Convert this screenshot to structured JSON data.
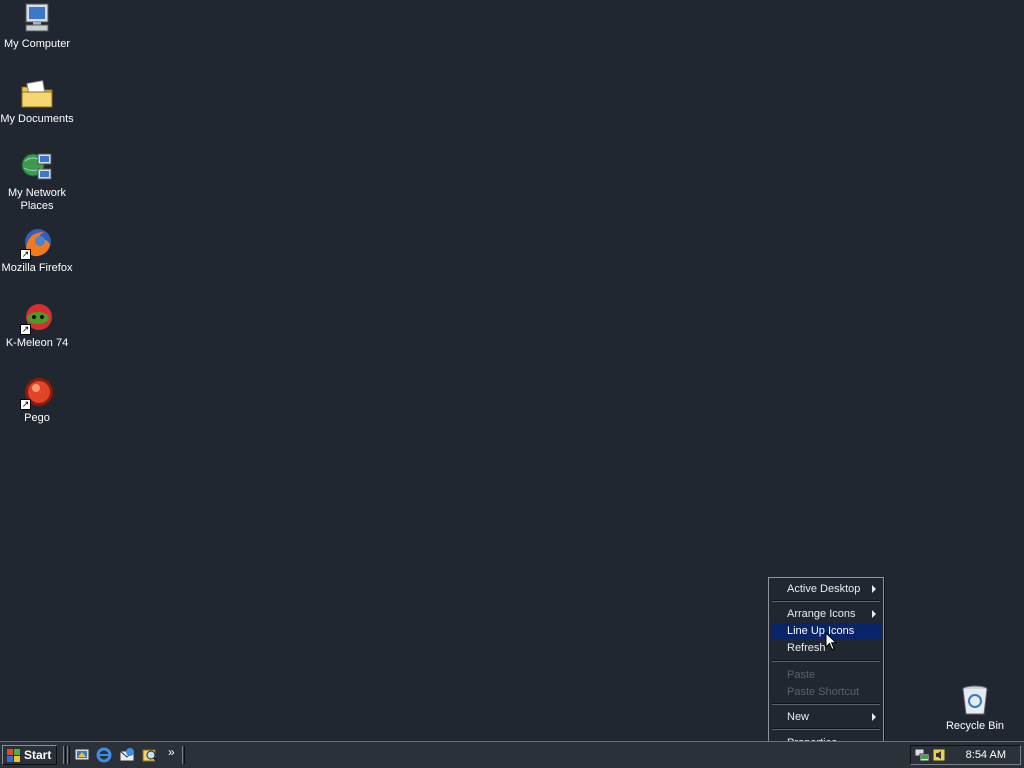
{
  "desktop": {
    "icons": [
      {
        "label_line1": "My Computer",
        "label_line2": "",
        "icon": "my-computer-icon",
        "shortcut": false
      },
      {
        "label_line1": "My Documents",
        "label_line2": "",
        "icon": "my-documents-icon",
        "shortcut": false
      },
      {
        "label_line1": "My Network",
        "label_line2": "Places",
        "icon": "network-places-icon",
        "shortcut": false
      },
      {
        "label_line1": "Mozilla Firefox",
        "label_line2": "",
        "icon": "firefox-icon",
        "shortcut": true
      },
      {
        "label_line1": "K-Meleon 74",
        "label_line2": "",
        "icon": "k-meleon-icon",
        "shortcut": true
      },
      {
        "label_line1": "Pego",
        "label_line2": "",
        "icon": "pego-icon",
        "shortcut": true
      }
    ],
    "recycle_bin": {
      "label": "Recycle Bin",
      "icon": "recycle-bin-icon"
    }
  },
  "context_menu": {
    "items": [
      {
        "label": "Active Desktop",
        "submenu": true,
        "disabled": false,
        "highlighted": false
      },
      {
        "label": "Arrange Icons",
        "submenu": true,
        "disabled": false,
        "highlighted": false
      },
      {
        "label": "Line Up Icons",
        "submenu": false,
        "disabled": false,
        "highlighted": true
      },
      {
        "label": "Refresh",
        "submenu": false,
        "disabled": false,
        "highlighted": false
      },
      {
        "label": "Paste",
        "submenu": false,
        "disabled": true,
        "highlighted": false
      },
      {
        "label": "Paste Shortcut",
        "submenu": false,
        "disabled": true,
        "highlighted": false
      },
      {
        "label": "New",
        "submenu": true,
        "disabled": false,
        "highlighted": false
      },
      {
        "label": "Properties",
        "submenu": false,
        "disabled": false,
        "highlighted": false
      }
    ]
  },
  "taskbar": {
    "start_label": "Start",
    "quick_launch": [
      "show-desktop-icon",
      "internet-explorer-icon",
      "outlook-express-icon",
      "search-icon"
    ],
    "overflow": "»",
    "tray_icons": [
      "network-tray-icon",
      "volume-tray-icon"
    ],
    "clock": "8:54 AM"
  },
  "colors": {
    "desktop_bg": "#212731",
    "menu_highlight": "#0a246a",
    "disabled_text": "#5b6068"
  }
}
